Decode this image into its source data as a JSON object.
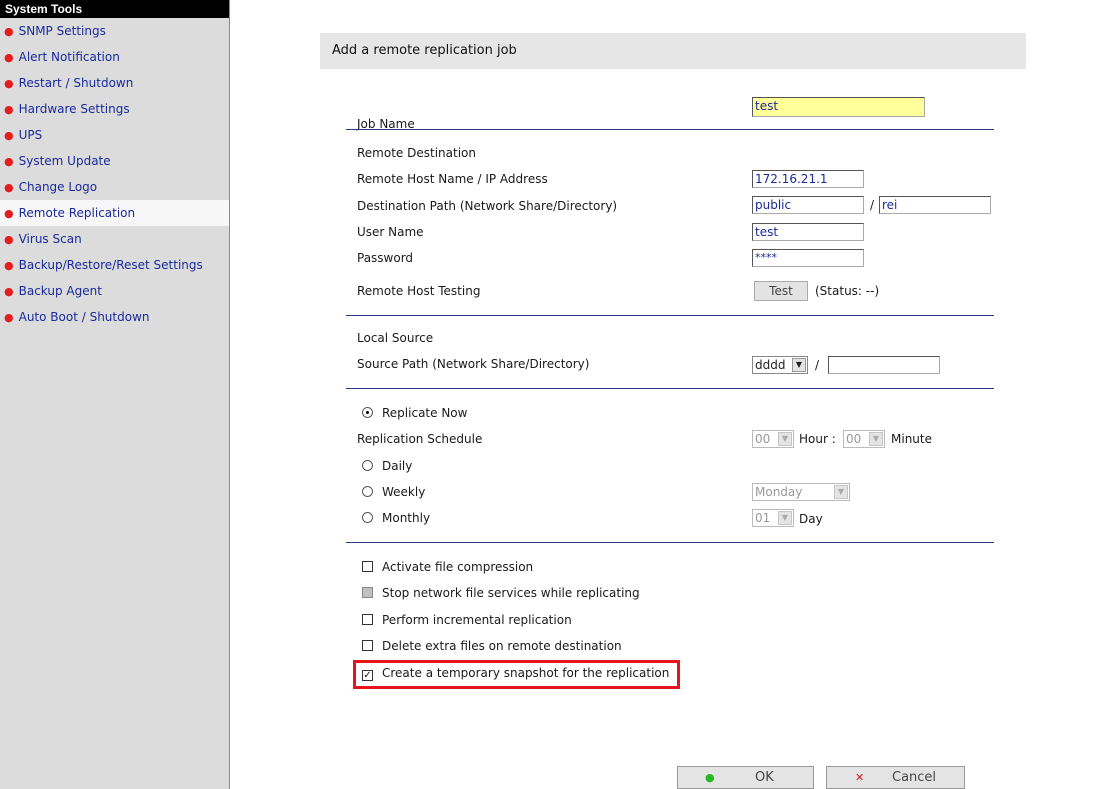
{
  "sidebar": {
    "title": "System Tools",
    "items": [
      {
        "label": "SNMP Settings"
      },
      {
        "label": "Alert Notification"
      },
      {
        "label": "Restart / Shutdown"
      },
      {
        "label": "Hardware Settings"
      },
      {
        "label": "UPS"
      },
      {
        "label": "System Update"
      },
      {
        "label": "Change Logo"
      },
      {
        "label": "Remote Replication",
        "active": true
      },
      {
        "label": "Virus Scan"
      },
      {
        "label": "Backup/Restore/Reset Settings"
      },
      {
        "label": "Backup Agent"
      },
      {
        "label": "Auto Boot / Shutdown"
      }
    ]
  },
  "panel": {
    "title": "Add a remote replication job",
    "job_name_label": "Job Name",
    "job_name_value": "test",
    "remote_destination_label": "Remote Destination",
    "remote_host_label": "Remote Host Name / IP Address",
    "remote_host_value": "172.16.21.1",
    "dest_path_label": "Destination Path (Network Share/Directory)",
    "dest_share_value": "public",
    "dest_dir_value": "rei",
    "path_sep": "/",
    "user_name_label": "User Name",
    "user_name_value": "test",
    "password_label": "Password",
    "password_value": "****",
    "host_testing_label": "Remote Host Testing",
    "test_button": "Test",
    "status_text": "(Status: --)",
    "local_source_label": "Local Source",
    "source_path_label": "Source Path (Network Share/Directory)",
    "source_share_value": "dddd",
    "source_dir_value": "",
    "replicate_now_label": "Replicate Now",
    "schedule_label": "Replication Schedule",
    "hour_value": "00",
    "hour_label": "Hour :",
    "minute_value": "00",
    "minute_label": "Minute",
    "daily_label": "Daily",
    "weekly_label": "Weekly",
    "weekday_value": "Monday",
    "monthly_label": "Monthly",
    "day_value": "01",
    "day_label": "Day",
    "options": {
      "compression": "Activate file compression",
      "stop_services": "Stop network file services while replicating",
      "incremental": "Perform incremental replication",
      "delete_extra": "Delete extra files on remote destination",
      "snapshot": "Create a temporary snapshot for the replication"
    },
    "ok_button": "OK",
    "cancel_button": "Cancel"
  },
  "colors": {
    "sidebar_link": "#1a2a9c",
    "bullet": "#e02020",
    "separator": "#2b3b8c",
    "highlight_box": "#e8131b",
    "job_name_bg": "#ffff99"
  }
}
